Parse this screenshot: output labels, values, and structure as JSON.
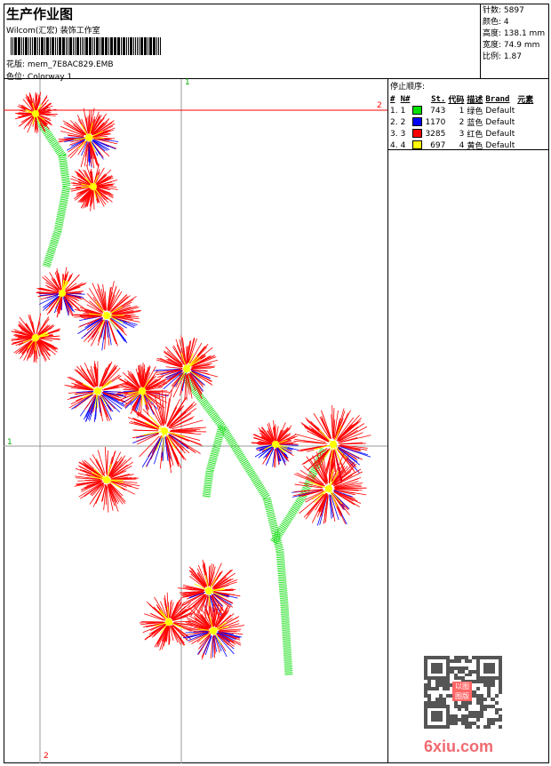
{
  "header": {
    "title": "生产作业图",
    "company": "Wilcom(汇宏) 装饰工作室",
    "design_label": "花版:",
    "design_value": "mem_7E8AC829.EMB",
    "colorway_label": "色位:",
    "colorway_value": "Colorway 1"
  },
  "stats": [
    {
      "label": "针数:",
      "value": "5897"
    },
    {
      "label": "颜色:",
      "value": "4"
    },
    {
      "label": "高度:",
      "value": "138.1 mm"
    },
    {
      "label": "宽度:",
      "value": "74.9 mm"
    },
    {
      "label": "比例:",
      "value": "1.87"
    }
  ],
  "stop_sequence": {
    "title": "停止顺序:",
    "columns": [
      "#",
      "N#",
      "St.",
      "代码",
      "描述",
      "Brand",
      "元素"
    ],
    "rows": [
      {
        "idx": "1.",
        "n": "1",
        "color": "#00e000",
        "st": "743",
        "code": "1",
        "desc": "绿色",
        "brand": "Default"
      },
      {
        "idx": "2.",
        "n": "2",
        "color": "#0000ff",
        "st": "1170",
        "code": "2",
        "desc": "蓝色",
        "brand": "Default"
      },
      {
        "idx": "3.",
        "n": "3",
        "color": "#ff0000",
        "st": "3285",
        "code": "3",
        "desc": "红色",
        "brand": "Default"
      },
      {
        "idx": "4.",
        "n": "4",
        "color": "#ffff00",
        "st": "697",
        "code": "4",
        "desc": "黄色",
        "brand": "Default"
      }
    ]
  },
  "markers": {
    "v1": "1",
    "h2": "2",
    "h1": "1",
    "v2": "2"
  },
  "watermark": {
    "site": "6xiu.com",
    "stamp": "以图版服"
  }
}
